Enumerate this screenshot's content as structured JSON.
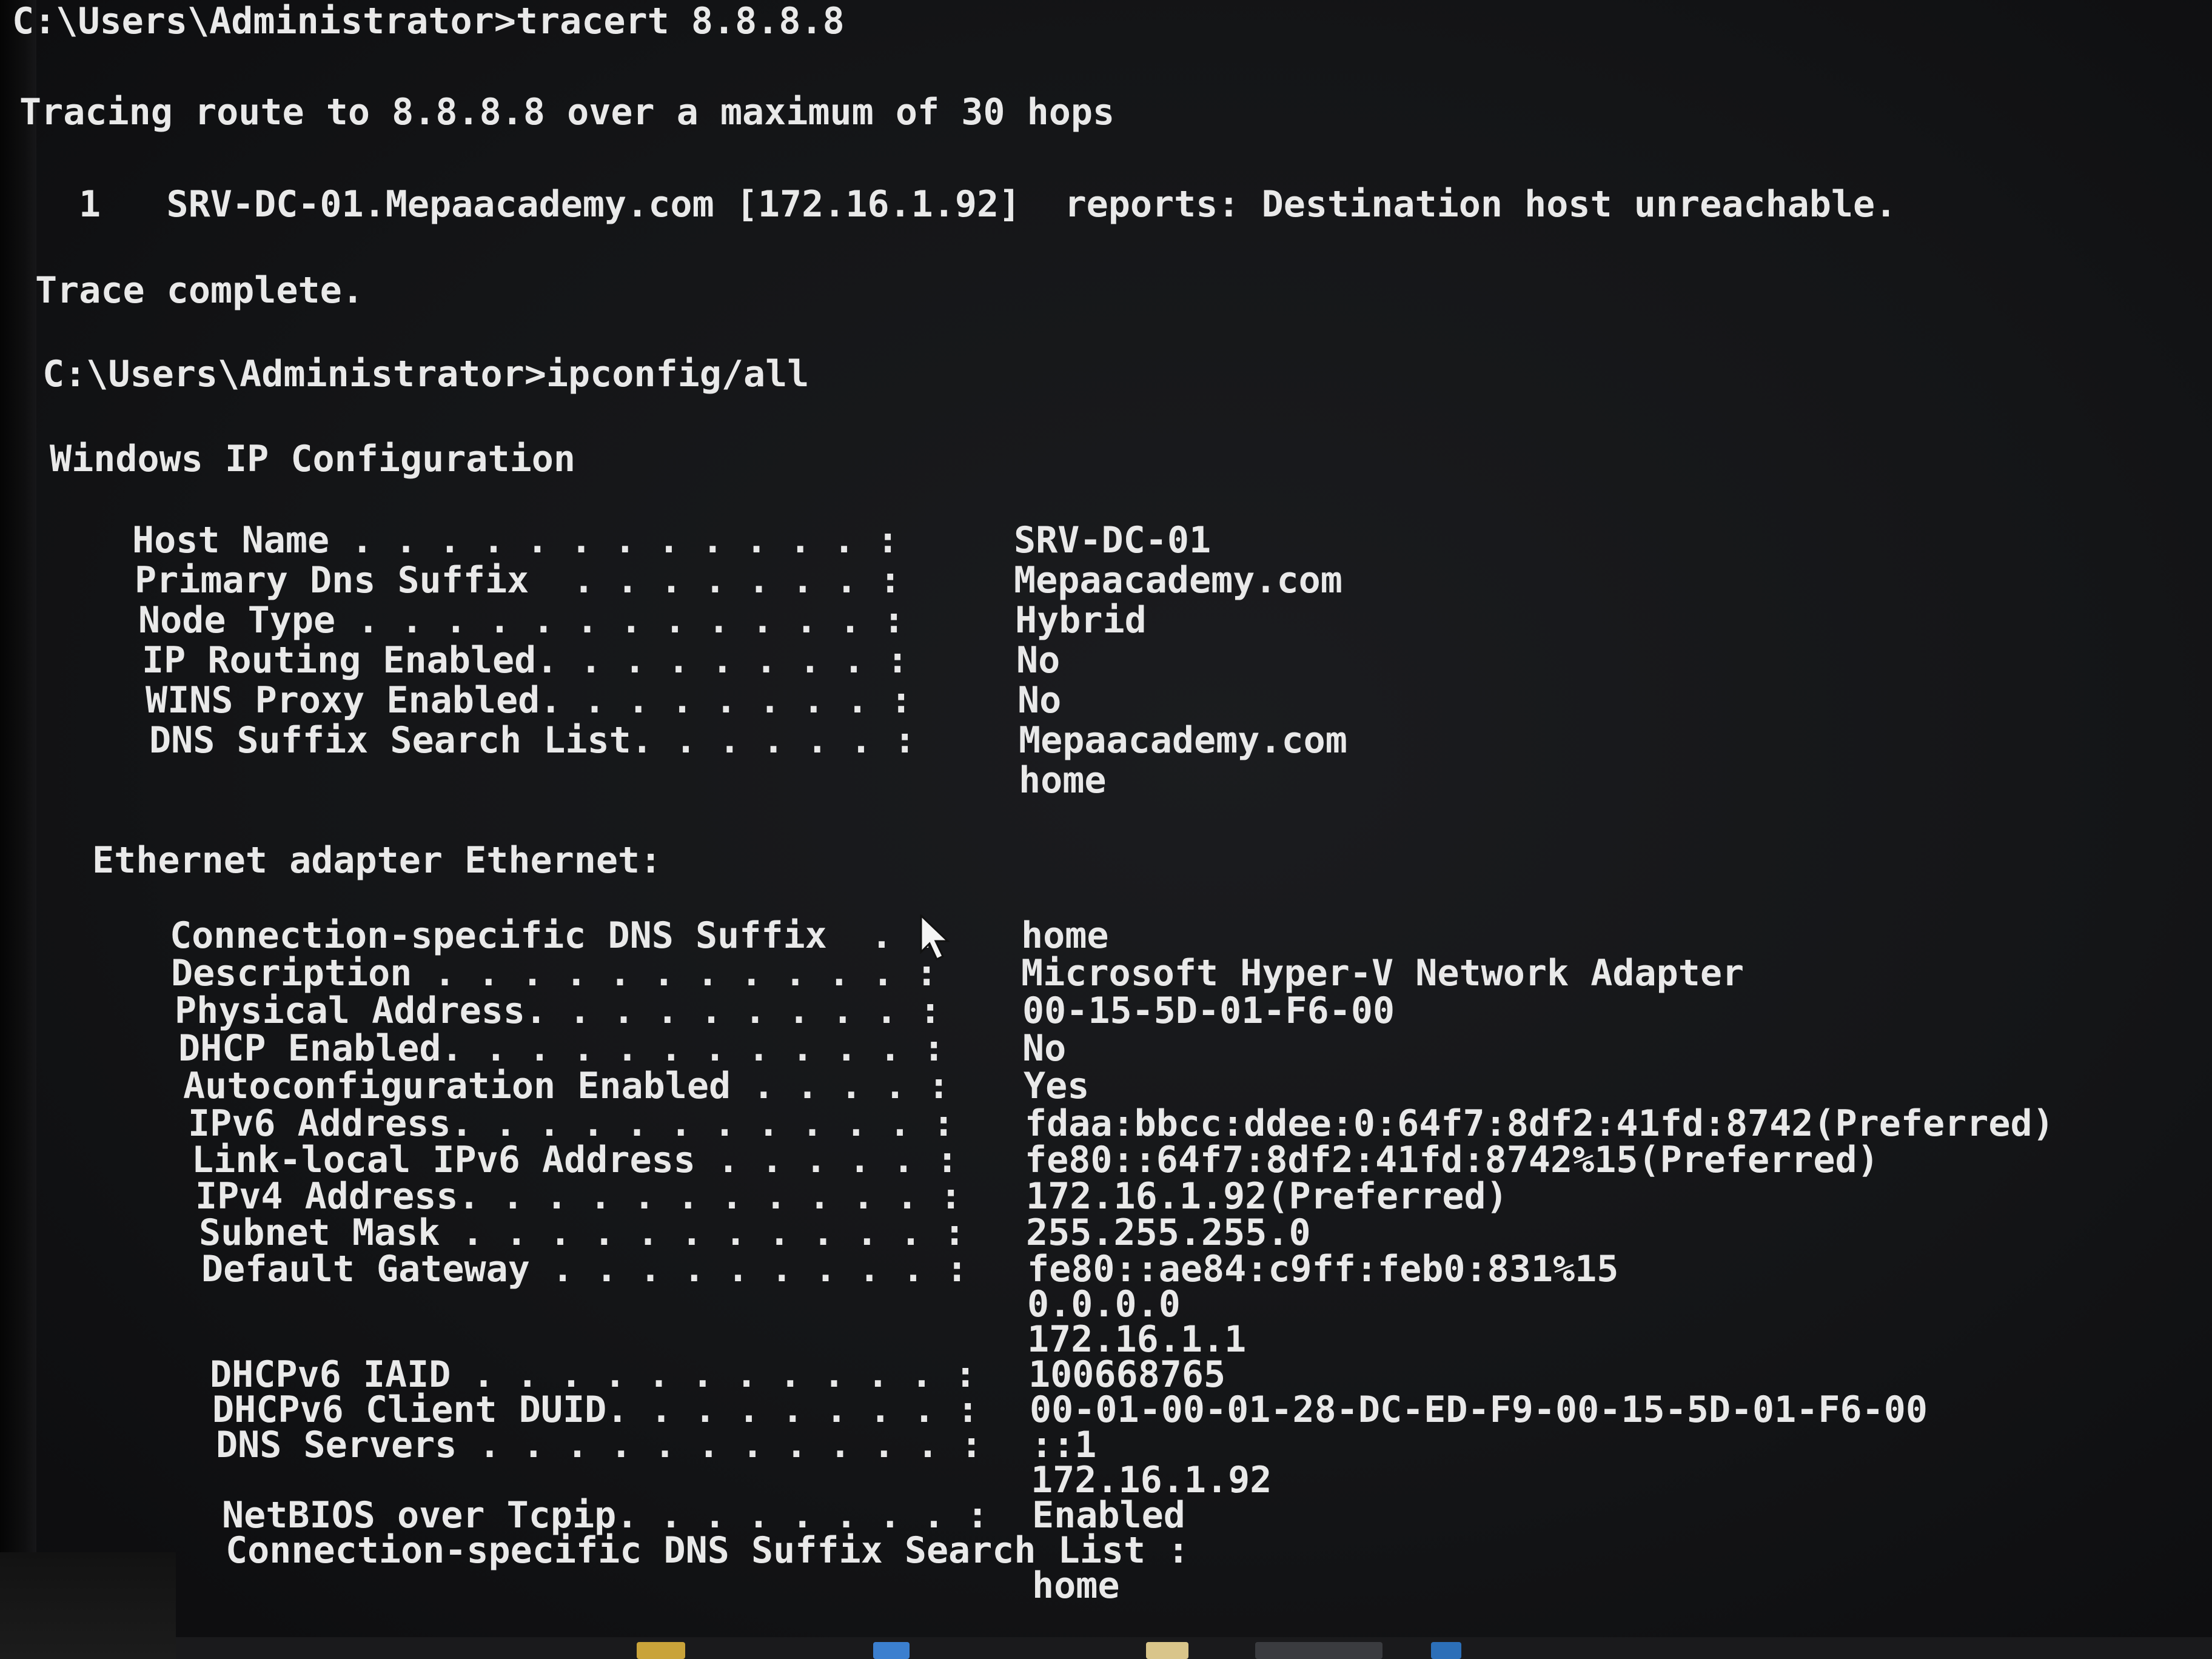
{
  "prompt": "C:\\Users\\Administrator>",
  "cmd1": "tracert 8.8.8.8",
  "trace_header": "Tracing route to 8.8.8.8 over a maximum of 30 hops",
  "hop": {
    "num": "1",
    "host": "SRV-DC-01.Mepaacademy.com [172.16.1.92]",
    "report": "reports: Destination host unreachable."
  },
  "trace_complete": "Trace complete.",
  "cmd2": "ipconfig/all",
  "win_ip_title": "Windows IP Configuration",
  "global": [
    {
      "label": "Host Name . . . . . . . . . . . . :",
      "value": "SRV-DC-01"
    },
    {
      "label": "Primary Dns Suffix  . . . . . . . :",
      "value": "Mepaacademy.com"
    },
    {
      "label": "Node Type . . . . . . . . . . . . :",
      "value": "Hybrid"
    },
    {
      "label": "IP Routing Enabled. . . . . . . . :",
      "value": "No"
    },
    {
      "label": "WINS Proxy Enabled. . . . . . . . :",
      "value": "No"
    },
    {
      "label": "DNS Suffix Search List. . . . . . :",
      "value": "Mepaacademy.com"
    },
    {
      "label": "",
      "value": "home"
    }
  ],
  "adapter_title": "Ethernet adapter Ethernet:",
  "adapter": [
    {
      "label": "Connection-specific DNS Suffix  . :",
      "value": "home"
    },
    {
      "label": "Description . . . . . . . . . . . :",
      "value": "Microsoft Hyper-V Network Adapter"
    },
    {
      "label": "Physical Address. . . . . . . . . :",
      "value": "00-15-5D-01-F6-00"
    },
    {
      "label": "DHCP Enabled. . . . . . . . . . . :",
      "value": "No"
    },
    {
      "label": "Autoconfiguration Enabled . . . . :",
      "value": "Yes"
    },
    {
      "label": "IPv6 Address. . . . . . . . . . . :",
      "value": "fdaa:bbcc:ddee:0:64f7:8df2:41fd:8742(Preferred)"
    },
    {
      "label": "Link-local IPv6 Address . . . . . :",
      "value": "fe80::64f7:8df2:41fd:8742%15(Preferred)"
    },
    {
      "label": "IPv4 Address. . . . . . . . . . . :",
      "value": "172.16.1.92(Preferred)"
    },
    {
      "label": "Subnet Mask . . . . . . . . . . . :",
      "value": "255.255.255.0"
    },
    {
      "label": "Default Gateway . . . . . . . . . :",
      "value": "fe80::ae84:c9ff:feb0:831%15"
    },
    {
      "label": "",
      "value": "0.0.0.0"
    },
    {
      "label": "",
      "value": "172.16.1.1"
    },
    {
      "label": "DHCPv6 IAID . . . . . . . . . . . :",
      "value": "100668765"
    },
    {
      "label": "DHCPv6 Client DUID. . . . . . . . :",
      "value": "00-01-00-01-28-DC-ED-F9-00-15-5D-01-F6-00"
    },
    {
      "label": "DNS Servers . . . . . . . . . . . :",
      "value": "::1"
    },
    {
      "label": "",
      "value": "172.16.1.92"
    },
    {
      "label": "NetBIOS over Tcpip. . . . . . . . :",
      "value": "Enabled"
    },
    {
      "label": "Connection-specific DNS Suffix Search List :",
      "value": ""
    },
    {
      "label": "",
      "value": "home"
    }
  ]
}
